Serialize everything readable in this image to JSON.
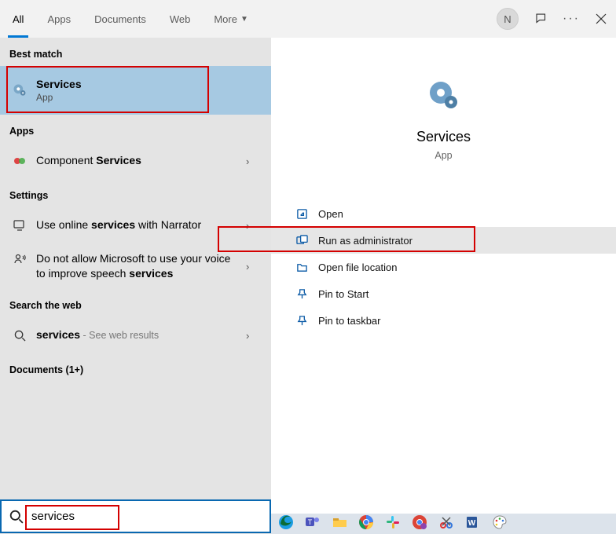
{
  "tabs": {
    "all": "All",
    "apps": "Apps",
    "documents": "Documents",
    "web": "Web",
    "more": "More"
  },
  "titlebar": {
    "avatar_initial": "N"
  },
  "left": {
    "best_match_label": "Best match",
    "best_match": {
      "title": "Services",
      "sub": "App"
    },
    "apps_label": "Apps",
    "app_result": {
      "prefix": "Component ",
      "match": "Services"
    },
    "settings_label": "Settings",
    "setting1": {
      "prefix": "Use online ",
      "match": "services",
      "suffix": " with Narrator"
    },
    "setting2": {
      "prefix": "Do not allow Microsoft to use your voice to improve speech ",
      "match": "services"
    },
    "web_label": "Search the web",
    "web_result": {
      "match": "services",
      "suffix": " - See web results"
    },
    "documents_label": "Documents (1+)"
  },
  "right": {
    "title": "Services",
    "sub": "App",
    "actions": {
      "open": "Open",
      "runadmin": "Run as administrator",
      "openloc": "Open file location",
      "pinstart": "Pin to Start",
      "pintask": "Pin to taskbar"
    }
  },
  "search": {
    "value": "services"
  }
}
